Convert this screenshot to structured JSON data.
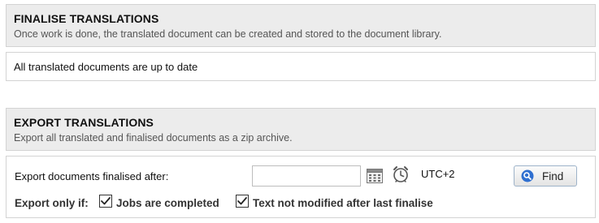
{
  "finalise": {
    "title": "FINALISE TRANSLATIONS",
    "description": "Once work is done, the translated document can be created and stored to the document library.",
    "status": "All translated documents are up to date"
  },
  "export": {
    "title": "EXPORT TRANSLATIONS",
    "description": "Export all translated and finalised documents as a zip archive.",
    "finalised_after_label": "Export documents finalised after:",
    "date_value": "",
    "timezone": "UTC+2",
    "find_label": "Find",
    "only_if_label": "Export only if:",
    "conditions": [
      {
        "label": "Jobs are completed",
        "checked": true
      },
      {
        "label": "Text not modified after last finalise",
        "checked": true
      }
    ]
  },
  "icons": {
    "calendar": "calendar-icon",
    "clock": "clock-icon",
    "search": "search-icon",
    "checkbox_checked": "checkbox-checked-icon"
  },
  "colors": {
    "header_bg": "#ececec",
    "border": "#d3d3d3",
    "search_badge": "#2f6fd0"
  }
}
